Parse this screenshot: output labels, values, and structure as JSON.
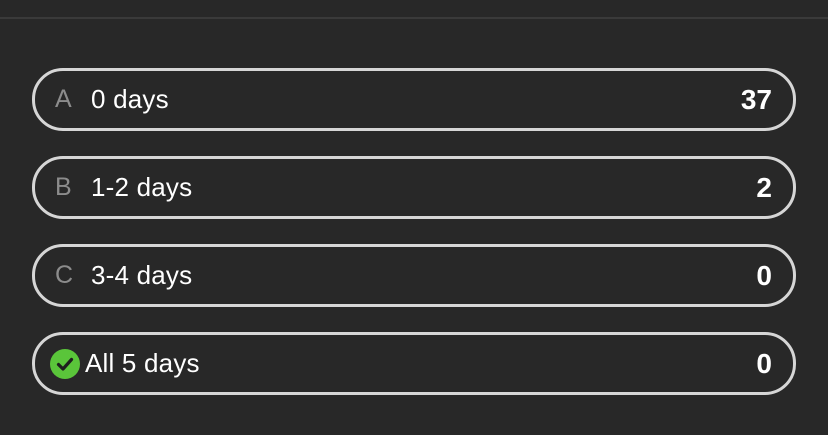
{
  "options": [
    {
      "letter": "A",
      "label": "0 days",
      "count": "37"
    },
    {
      "letter": "B",
      "label": "1-2 days",
      "count": "2"
    },
    {
      "letter": "C",
      "label": "3-4 days",
      "count": "0"
    },
    {
      "letter": "",
      "label": "All 5 days",
      "count": "0",
      "icon": "checkmark-circle-icon",
      "icon_color": "#5ac53a"
    }
  ],
  "colors": {
    "background": "#282828",
    "option_border": "#d6d6d6",
    "letter": "#8c8c8c",
    "text": "#ffffff"
  }
}
